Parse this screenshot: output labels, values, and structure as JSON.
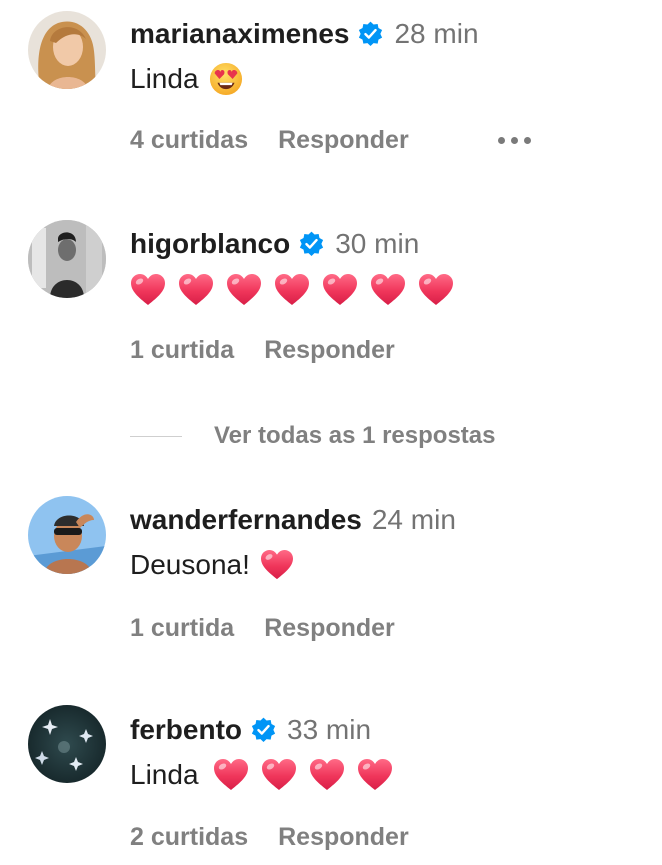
{
  "comments": [
    {
      "username": "marianaximenes",
      "verified": true,
      "time": "28 min",
      "text": "Linda",
      "emoji": "star-struck-face",
      "likes": "4 curtidas",
      "reply": "Responder",
      "more": "more-options"
    },
    {
      "username": "higorblanco",
      "verified": true,
      "time": "30 min",
      "text": "",
      "hearts": 7,
      "likes": "1 curtida",
      "reply": "Responder",
      "view_replies": "Ver todas as 1 respostas"
    },
    {
      "username": "wanderfernandes",
      "verified": false,
      "time": "24 min",
      "text": "Deusona!",
      "hearts": 1,
      "likes": "1 curtida",
      "reply": "Responder"
    },
    {
      "username": "ferbento",
      "verified": true,
      "time": "33 min",
      "text": "Linda",
      "hearts": 4,
      "likes": "2 curtidas",
      "reply": "Responder"
    }
  ],
  "colors": {
    "verified_blue": "#0095f6",
    "heart_pink": "#f0365b",
    "muted_text": "#808080",
    "time_text": "#737373"
  },
  "icons": {
    "verified": "verified-badge-icon",
    "heart": "pink-heart-emoji",
    "more": "more-dots-icon"
  }
}
